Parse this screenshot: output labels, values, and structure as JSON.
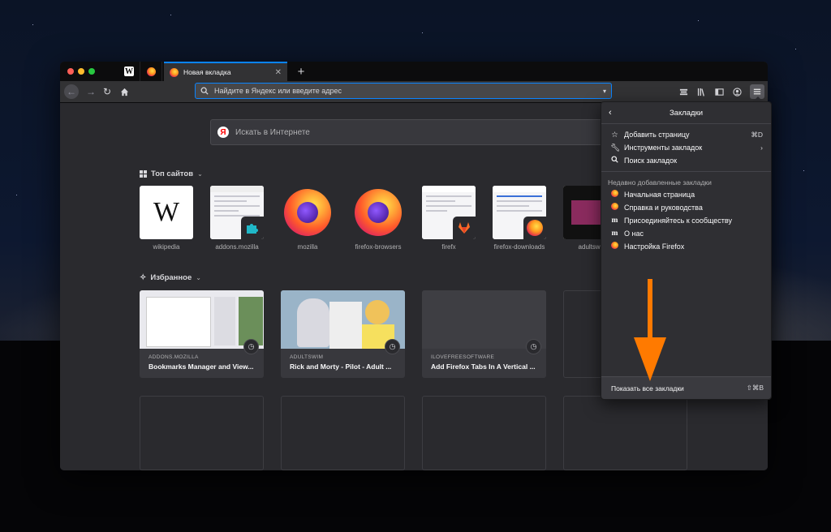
{
  "browser": {
    "pinned_tabs": [
      {
        "icon": "wikipedia-favicon"
      },
      {
        "icon": "firefox-favicon"
      }
    ],
    "active_tab": {
      "title": "Новая вкладка",
      "icon": "firefox-favicon"
    },
    "new_tab_symbol": "+",
    "urlbar": {
      "placeholder": "Найдите в Яндекс или введите адрес",
      "value": ""
    }
  },
  "newtab": {
    "search": {
      "placeholder": "Искать в Интернете"
    },
    "top_sites": {
      "title": "Топ сайтов",
      "items": [
        {
          "name": "wikipedia"
        },
        {
          "name": "addons.mozilla"
        },
        {
          "name": "mozilla"
        },
        {
          "name": "firefox-browsers"
        },
        {
          "name": "firefx"
        },
        {
          "name": "firefox-downloads"
        },
        {
          "name": "adultswi"
        }
      ]
    },
    "highlights": {
      "title": "Избранное",
      "cards": [
        {
          "source": "ADDONS.MOZILLA",
          "title": "Bookmarks Manager and View..."
        },
        {
          "source": "ADULTSWIM",
          "title": "Rick and Morty - Pilot - Adult ..."
        },
        {
          "source": "ILOVEFREESOFTWARE",
          "title": "Add Firefox Tabs In A Vertical ..."
        }
      ]
    }
  },
  "bookmarks_panel": {
    "title": "Закладки",
    "actions": [
      {
        "label": "Добавить страницу",
        "shortcut": "⌘D",
        "icon": "star-icon"
      },
      {
        "label": "Инструменты закладок",
        "shortcut": "›",
        "icon": "wrench-icon"
      },
      {
        "label": "Поиск закладок",
        "shortcut": "",
        "icon": "search-icon"
      }
    ],
    "recent_header": "Недавно добавленные закладки",
    "recent": [
      {
        "label": "Начальная страница",
        "icon": "firefox-favicon"
      },
      {
        "label": "Справка и руководства",
        "icon": "firefox-favicon"
      },
      {
        "label": "Присоединяйтесь к сообществу",
        "icon": "mozilla-m-icon"
      },
      {
        "label": "О нас",
        "icon": "mozilla-m-icon"
      },
      {
        "label": "Настройка Firefox",
        "icon": "firefox-favicon"
      }
    ],
    "footer": {
      "label": "Показать все закладки",
      "shortcut": "⇧⌘B"
    }
  },
  "colors": {
    "accent": "#0a84ff",
    "annotation_arrow": "#ff7a00"
  }
}
